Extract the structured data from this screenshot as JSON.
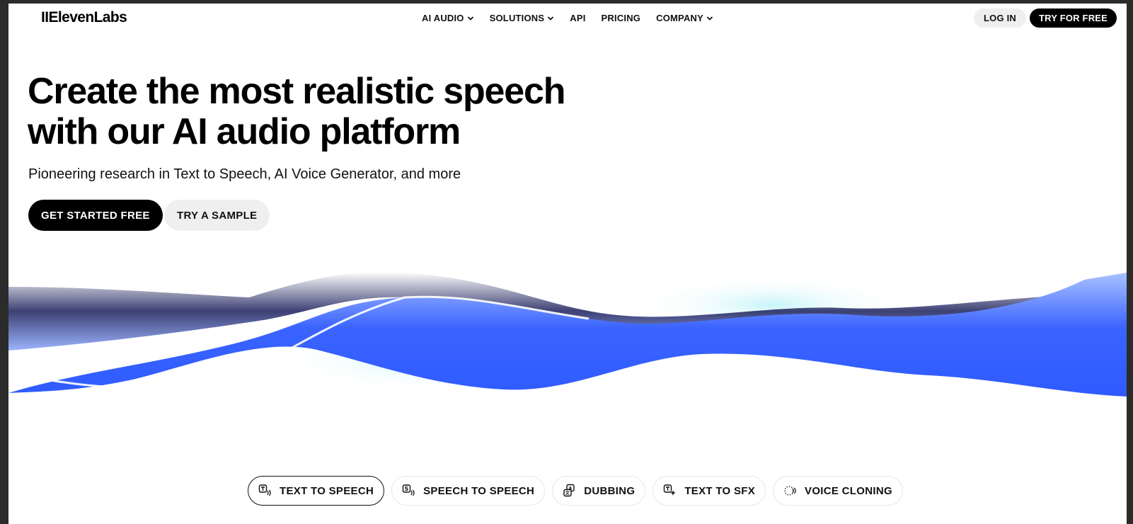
{
  "header": {
    "logo": "IIElevenLabs",
    "nav": [
      {
        "label": "AI AUDIO",
        "dropdown": true
      },
      {
        "label": "SOLUTIONS",
        "dropdown": true
      },
      {
        "label": "API",
        "dropdown": false
      },
      {
        "label": "PRICING",
        "dropdown": false
      },
      {
        "label": "COMPANY",
        "dropdown": true
      }
    ],
    "login_label": "LOG IN",
    "try_label": "TRY FOR FREE"
  },
  "hero": {
    "title_line1": "Create the most realistic speech",
    "title_line2": "with our AI audio platform",
    "subtitle": "Pioneering research in Text to Speech, AI Voice Generator, and more",
    "primary_cta": "GET STARTED FREE",
    "secondary_cta": "TRY A SAMPLE"
  },
  "tabs": [
    {
      "label": "TEXT TO SPEECH",
      "icon": "text-to-speech-icon",
      "active": true
    },
    {
      "label": "SPEECH TO SPEECH",
      "icon": "speech-to-speech-icon",
      "active": false
    },
    {
      "label": "DUBBING",
      "icon": "dubbing-icon",
      "active": false
    },
    {
      "label": "TEXT TO SFX",
      "icon": "text-to-sfx-icon",
      "active": false
    },
    {
      "label": "VOICE CLONING",
      "icon": "voice-cloning-icon",
      "active": false
    }
  ],
  "colors": {
    "wave_blue": "#2f5bff",
    "wave_light": "#a9c2ff",
    "wave_cyan": "#c8f4f8",
    "wave_dark": "#1a1f5a"
  }
}
